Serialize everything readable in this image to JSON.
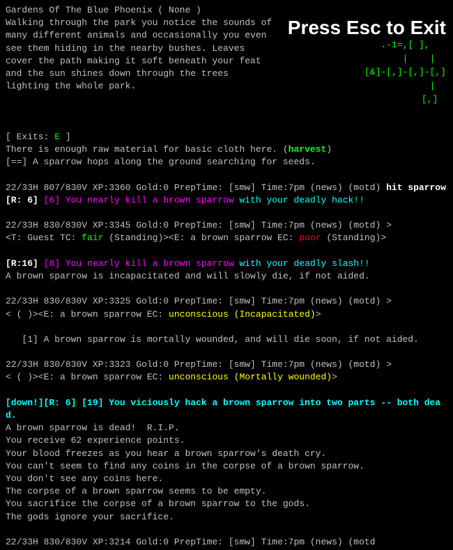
{
  "overlay": {
    "press_esc": "Press Esc to Exit"
  },
  "map": {
    "lines": [
      ".-1=,[ ],",
      "     |    |",
      "[&]-[,]-[,]-[,]",
      "          |",
      "         [,]"
    ]
  },
  "description": {
    "title": "Gardens Of The Blue Phoenix ( None )",
    "lines": [
      "Walking through the park you notice the sounds of",
      "many different animals and occasionally you even",
      "see them hiding in the nearby bushes. Leaves",
      "cover the path making it soft beneath your feat",
      "and the sun shines down through the trees",
      "lighting the whole park."
    ]
  },
  "exits": "[ Exits: E ]",
  "harvest_line": "There is enough raw material for basic cloth here. (harvest)",
  "sparrow_hops": "[==] A sparrow hops along the ground searching for seeds.",
  "combat_lines": [
    {
      "timestamp": "22/33H 807/830V XP:3360 Gold:0 PrepTime: [smw] Time:7pm (news) (motd)",
      "action": "hit sparrow",
      "action_color": "white_bold"
    },
    {
      "r_bracket": "[R: 6]",
      "detail": "[6] You nearly kill a brown sparrow with your deadly hack!!"
    },
    {
      "timestamp": "22/33H 830/830V XP:3345 Gold:0 PrepTime: [smw] Time:7pm (news) (motd) >"
    },
    {
      "target_line": "<T: Guest TC: fair (Standing)><E: a brown sparrow EC: poor (Standing)>"
    },
    {
      "blank": ""
    },
    {
      "r_bracket": "[R:16]",
      "detail": "[8] You nearly kill a brown sparrow with your deadly slash!!"
    },
    {
      "incap": "A brown sparrow is incapacitated and will slowly die, if not aided."
    },
    {
      "blank": ""
    },
    {
      "timestamp": "22/33H 830/830V XP:3325 Gold:0 PrepTime: [smw] Time:7pm (news) (motd) >"
    },
    {
      "move": "< ( )><E: a brown sparrow EC: unconscious (Incapacitated)>"
    },
    {
      "blank": ""
    },
    {
      "wounded": "   [1] A brown sparrow is mortally wounded, and will die soon, if not aided."
    },
    {
      "blank": ""
    },
    {
      "timestamp": "22/33H 830/830V XP:3323 Gold:0 PrepTime: [smw] Time:7pm (news) (motd) >"
    },
    {
      "move": "< ( )><E: a brown sparrow EC: unconscious (Mortally wounded)>"
    },
    {
      "blank": ""
    },
    {
      "kill_line": "[down!][R: 6] [19] You viciously hack a brown sparrow into two parts -- both dead."
    },
    {
      "death1": "A brown sparrow is dead!  R.I.P."
    },
    {
      "death2": "You receive 62 experience points."
    },
    {
      "death3": "Your blood freezes as you hear a brown sparrow's death cry."
    },
    {
      "death4": "You can't seem to find any coins in the corpse of a brown sparrow."
    },
    {
      "death5": "You don't see any coins here."
    },
    {
      "death6": "The corpse of a brown sparrow seems to be empty."
    },
    {
      "death7": "You sacrifice the corpse of a brown sparrow to the gods."
    },
    {
      "death8": "The gods ignore your sacrifice."
    },
    {
      "blank": ""
    },
    {
      "timestamp_last": "22/33H 830/830V XP:3214 Gold:0 PrepTime: [smw] Time:7pm (news) (motd"
    }
  ]
}
